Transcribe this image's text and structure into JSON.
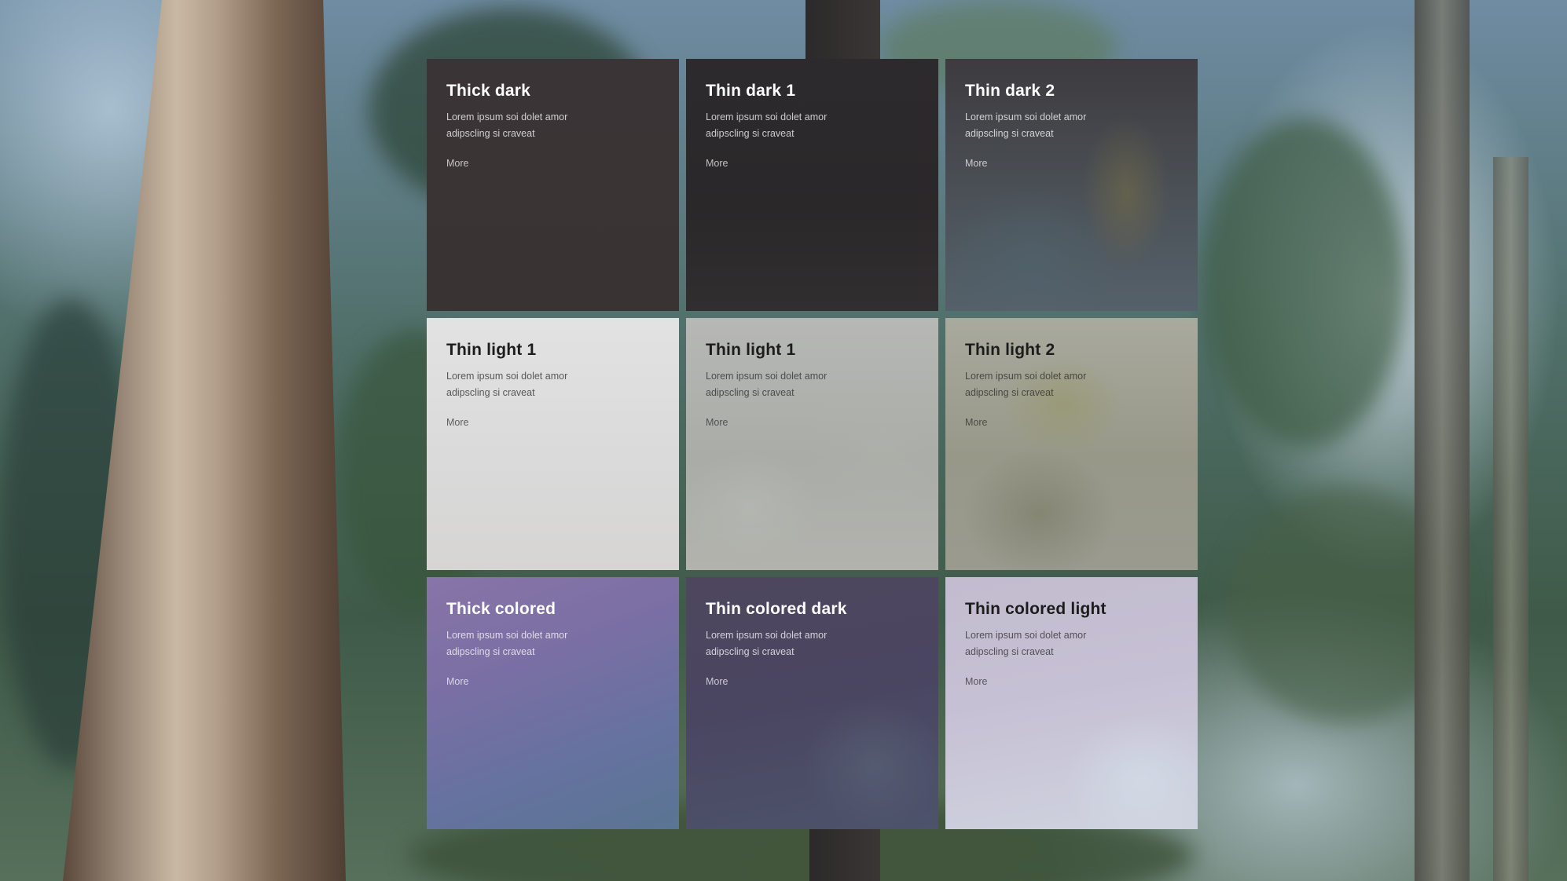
{
  "background": {
    "scene": "redwood-forest",
    "colors": {
      "sky": "#dbe7f2",
      "trunk": "#6b5646",
      "foliage": "#3f5a48"
    }
  },
  "tiles": [
    {
      "title": "Thick dark",
      "body": "Lorem ipsum soi dolet amor adipscling si craveat",
      "link": "More",
      "material": "#3b3436"
    },
    {
      "title": "Thin dark 1",
      "body": "Lorem ipsum soi dolet amor adipscling si craveat",
      "link": "More",
      "material": "#2c2a2d"
    },
    {
      "title": "Thin dark 2",
      "body": "Lorem ipsum soi dolet amor adipscling si craveat",
      "link": "More",
      "material": "#3d3b3f"
    },
    {
      "title": "Thin light 1",
      "body": "Lorem ipsum soi dolet amor adipscling si craveat",
      "link": "More",
      "material": "#e2e2e3"
    },
    {
      "title": "Thin light 1",
      "body": "Lorem ipsum soi dolet amor adipscling si craveat",
      "link": "More",
      "material": "#b7b8b5"
    },
    {
      "title": "Thin light 2",
      "body": "Lorem ipsum soi dolet amor adipscling si craveat",
      "link": "More",
      "material": "#a9aa9e"
    },
    {
      "title": "Thick colored",
      "body": "Lorem ipsum soi dolet amor adipscling si craveat",
      "link": "More",
      "material": "#8874a8"
    },
    {
      "title": "Thin colored dark",
      "body": "Lorem ipsum soi dolet amor adipscling si craveat",
      "link": "More",
      "material": "#4e465f"
    },
    {
      "title": "Thin colored light",
      "body": "Lorem ipsum soi dolet amor adipscling si craveat",
      "link": "More",
      "material": "#c3bccf"
    }
  ]
}
